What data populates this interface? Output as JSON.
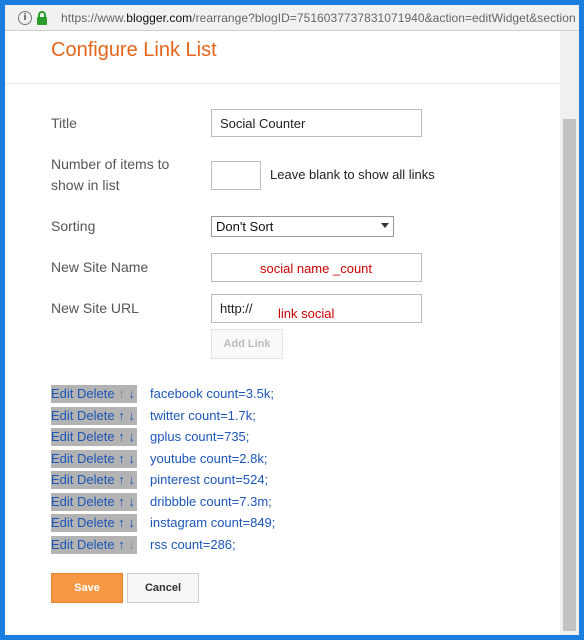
{
  "browser": {
    "url_prefix": "https://www.",
    "url_domain": "blogger.com",
    "url_rest": "/rearrange?blogID=7516037737831071940&action=editWidget&section"
  },
  "dialog": {
    "title": "Configure Link List",
    "fields": {
      "title_label": "Title",
      "title_value": "Social Counter",
      "items_label_line1": "Number of items to",
      "items_label_line2": "show in list",
      "items_value": "",
      "items_hint": "Leave blank to show all links",
      "sorting_label": "Sorting",
      "sorting_value": "Don't Sort",
      "site_name_label": "New Site Name",
      "site_name_value": "",
      "site_name_annotation": "social name _count",
      "site_url_label": "New Site URL",
      "site_url_value": "http://",
      "site_url_annotation": "link social"
    },
    "add_link_label": "Add Link",
    "link_controls": {
      "edit": "Edit",
      "delete": "Delete",
      "up": "↑",
      "down": "↓"
    },
    "links": [
      "facebook count=3.5k;",
      "twitter count=1.7k;",
      "gplus count=735;",
      "youtube count=2.8k;",
      "pinterest count=524;",
      "dribbble count=7.3m;",
      "instagram count=849;",
      "rss count=286;"
    ],
    "save_label": "Save",
    "cancel_label": "Cancel"
  },
  "colors": {
    "frame": "#1a7ee0",
    "title": "#e4661b",
    "link": "#1c56b8",
    "annotation": "#cc0000",
    "save_button": "#f69843"
  }
}
